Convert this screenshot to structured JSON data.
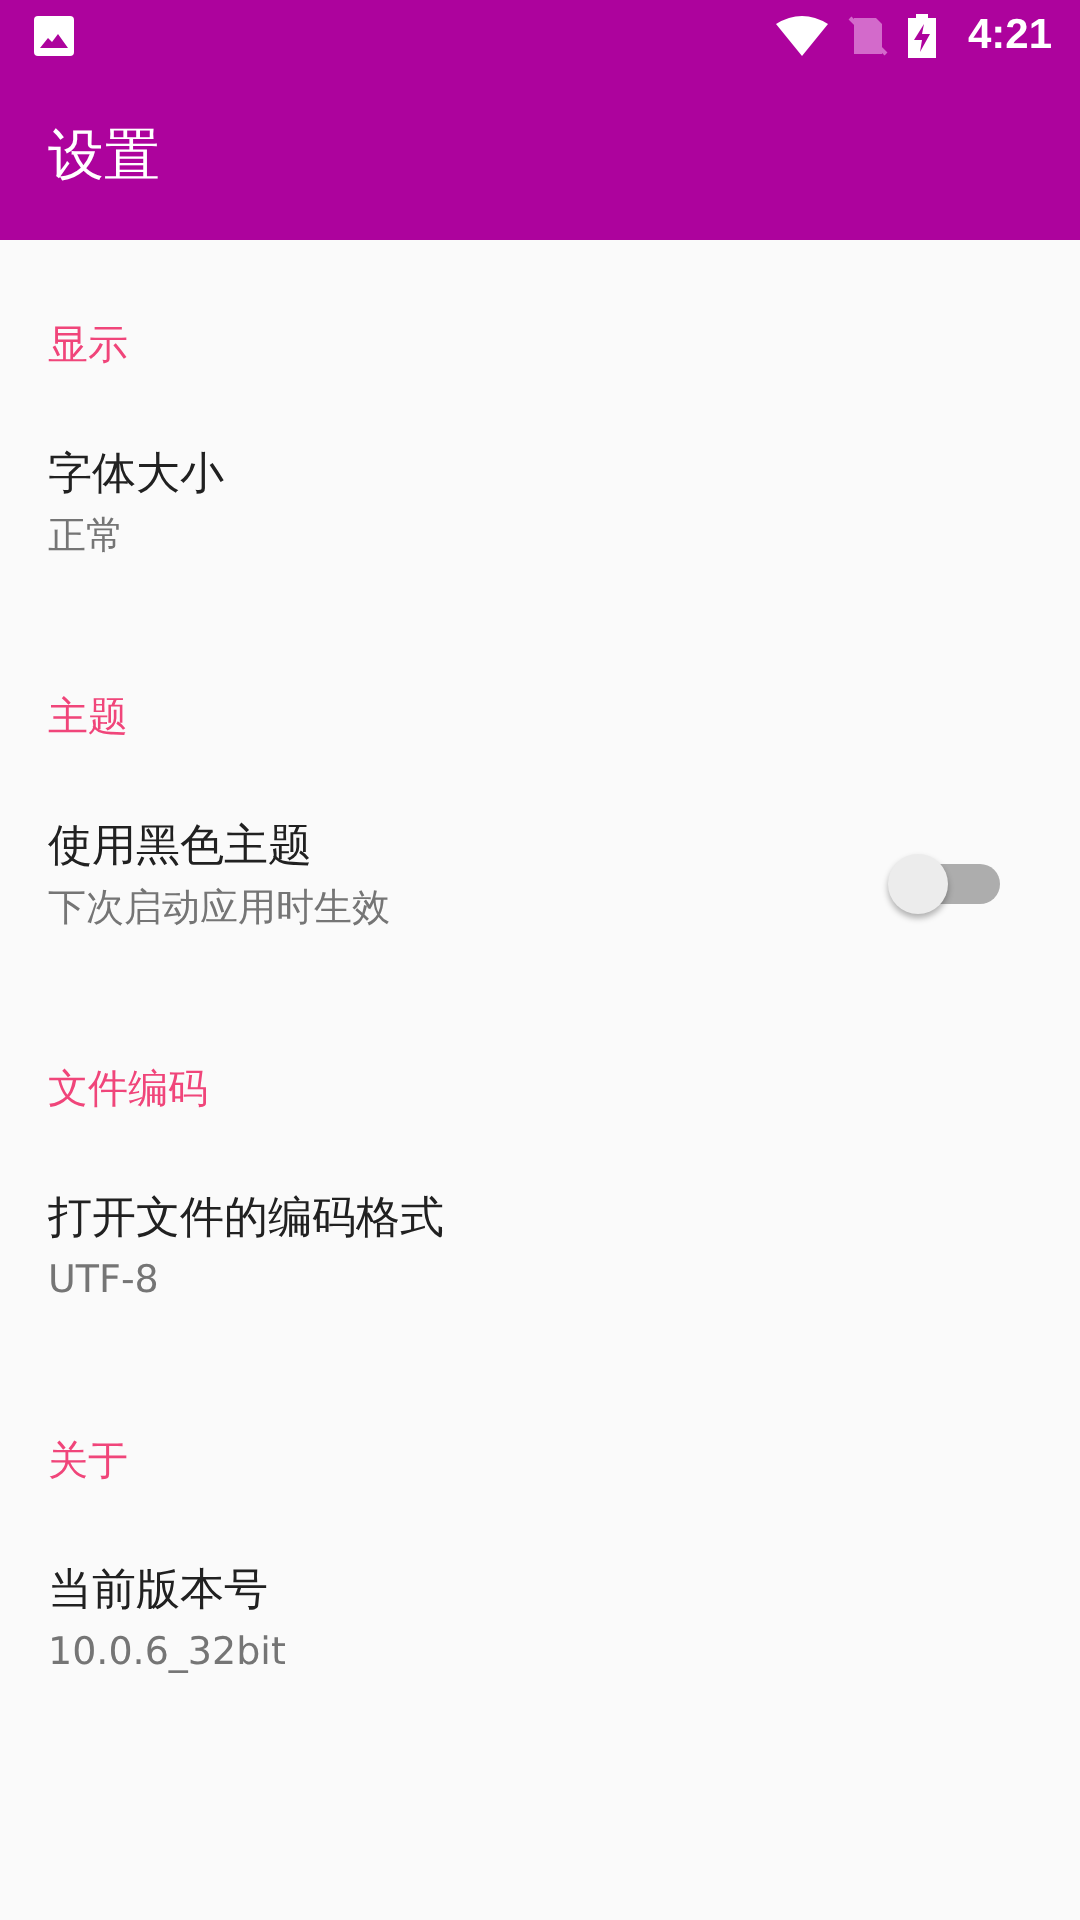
{
  "status_bar": {
    "time": "4:21"
  },
  "app_bar": {
    "title": "设置"
  },
  "sections": [
    {
      "header": "显示",
      "items": [
        {
          "kind": "text",
          "title": "字体大小",
          "summary": "正常"
        }
      ]
    },
    {
      "header": "主题",
      "items": [
        {
          "kind": "switch",
          "title": "使用黑色主题",
          "summary": "下次启动应用时生效",
          "on": false
        }
      ]
    },
    {
      "header": "文件编码",
      "items": [
        {
          "kind": "text",
          "title": "打开文件的编码格式",
          "summary": "UTF-8"
        }
      ]
    },
    {
      "header": "关于",
      "items": [
        {
          "kind": "text",
          "title": "当前版本号",
          "summary": "10.0.6_32bit"
        }
      ]
    }
  ]
}
